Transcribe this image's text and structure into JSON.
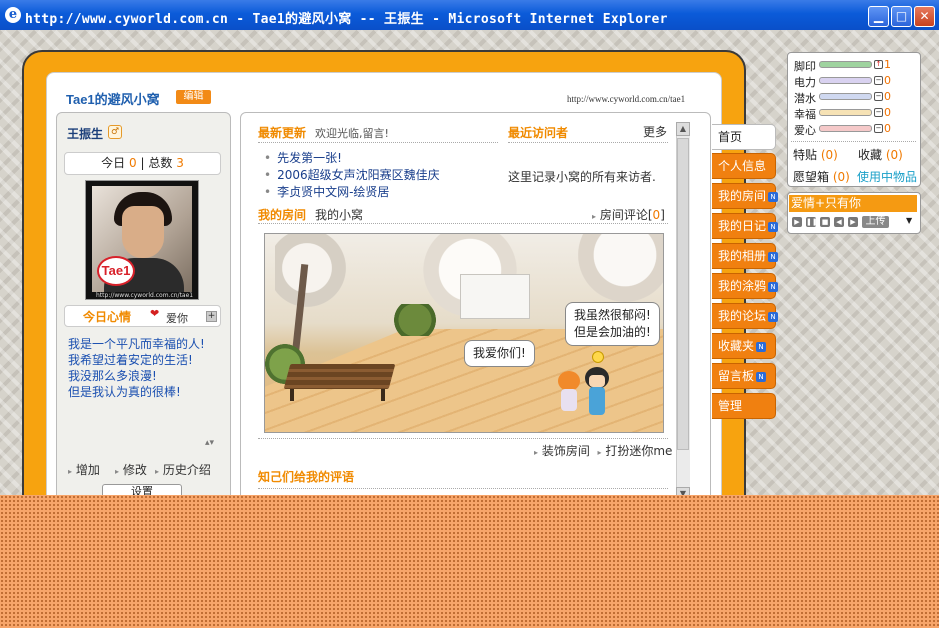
{
  "window": {
    "title": "http://www.cyworld.com.cn - Tae1的避风小窝 -- 王振生 - Microsoft Internet Explorer",
    "minimize": "▁",
    "maximize": "□",
    "close": "✕"
  },
  "minihome": {
    "title": "Tae1的避风小窝",
    "edit": "编辑",
    "url": "http://www.cyworld.com.cn/tae1"
  },
  "profile": {
    "name": "王振生",
    "gender_icon": "♂",
    "today_label": "今日",
    "today_count": "0",
    "total_label": "总数",
    "total_count": "3",
    "photo_logo": "Tae1",
    "photo_url": "http://www.cyworld.com.cn/tae1",
    "mood_label": "今日心情",
    "mood_icon": "❤",
    "mood_text": "爱你",
    "mood_plus": "+",
    "bio": [
      "我是一个平凡而幸福的人!",
      "我希望过着安定的生活!",
      "我没那么多浪漫!",
      "但是我认为真的很棒!"
    ],
    "links": [
      "增加",
      "修改",
      "历史介绍"
    ],
    "settings": "设置"
  },
  "center": {
    "news_title": "最新更新",
    "news_sub": "欢迎光临,留言!",
    "news": [
      "先发第一张!",
      "2006超级女声沈阳赛区魏佳庆",
      "李贞贤中文网-绘贤居"
    ],
    "visitors_title": "最近访问者",
    "more": "更多",
    "visitors_note": "这里记录小窝的所有来访者.",
    "room_title": "我的房间",
    "room_sub": "我的小窝",
    "room_comment": "房间评论",
    "room_comment_count": "0",
    "bubble1": "我爱你们!",
    "bubble2_l1": "我虽然很郁闷!",
    "bubble2_l2": "但是会加油的!",
    "decorate": "装饰房间",
    "dress": "打扮迷你me",
    "friends_title": "知己们给我的评语"
  },
  "tabs": [
    {
      "label": "首页",
      "active": true,
      "new": false
    },
    {
      "label": "个人信息",
      "active": false,
      "new": false
    },
    {
      "label": "我的房间",
      "active": false,
      "new": true
    },
    {
      "label": "我的日记",
      "active": false,
      "new": true
    },
    {
      "label": "我的相册",
      "active": false,
      "new": true
    },
    {
      "label": "我的涂鸦",
      "active": false,
      "new": true
    },
    {
      "label": "我的论坛",
      "active": false,
      "new": true
    },
    {
      "label": "收藏夹",
      "active": false,
      "new": true
    },
    {
      "label": "留言板",
      "active": false,
      "new": true
    },
    {
      "label": "管理",
      "active": false,
      "new": false
    }
  ],
  "new_badge": "N",
  "stats": [
    {
      "label": "脚印",
      "value": "1",
      "icon": "↑",
      "color": "#9fd39f"
    },
    {
      "label": "电力",
      "value": "0",
      "icon": "−",
      "color": "#d9d2f0"
    },
    {
      "label": "潜水",
      "value": "0",
      "icon": "−",
      "color": "#cfd8f0"
    },
    {
      "label": "幸福",
      "value": "0",
      "icon": "−",
      "color": "#f6e2b5"
    },
    {
      "label": "爱心",
      "value": "0",
      "icon": "−",
      "color": "#f5c9c9"
    }
  ],
  "counters": {
    "special_label": "特贴",
    "special": "(0)",
    "collect_label": "收藏",
    "collect": "(0)",
    "wish_label": "愿望箱",
    "wish": "(0)",
    "use_items": "使用中物品"
  },
  "music": {
    "title": "爱情+只有你",
    "buttons": [
      "▶",
      "❚❚",
      "■",
      "◀",
      "▶"
    ],
    "up": "上传",
    "drop": "▼"
  },
  "scroll": {
    "up": "▲",
    "down": "▼"
  },
  "updown": "▴▾",
  "arrow": "▸"
}
